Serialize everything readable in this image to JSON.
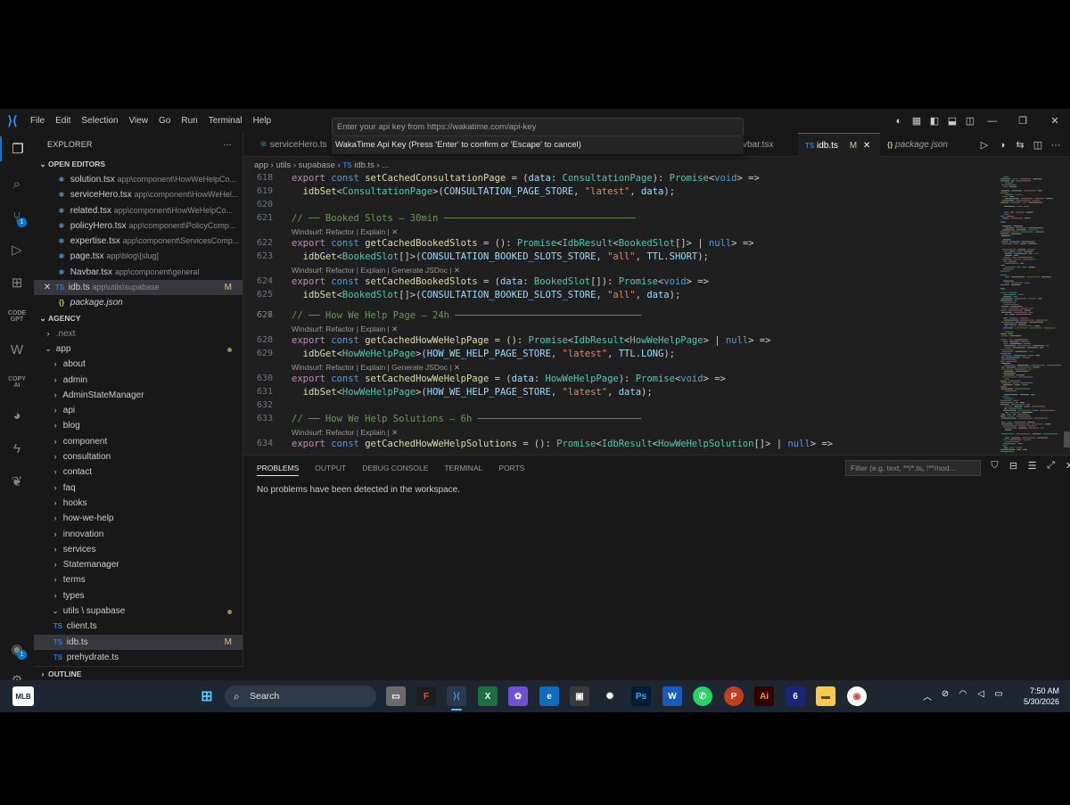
{
  "menu": [
    "File",
    "Edit",
    "Selection",
    "View",
    "Go",
    "Run",
    "Terminal",
    "Help"
  ],
  "command_palette": {
    "placeholder": "Enter your api key from https://wakatime.com/api-key",
    "hint": "WakaTime Api Key (Press 'Enter' to confirm or 'Escape' to cancel)"
  },
  "sidebar": {
    "title": "EXPLORER",
    "open_editors_title": "OPEN EDITORS",
    "open_editors": [
      {
        "name": "solution.tsx",
        "path": "app\\component\\HowWeHelpCo...",
        "icon": "react"
      },
      {
        "name": "serviceHero.tsx",
        "path": "app\\component\\HowWeHel...",
        "icon": "react"
      },
      {
        "name": "related.tsx",
        "path": "app\\component\\HowWeHelpCo...",
        "icon": "react"
      },
      {
        "name": "policyHero.tsx",
        "path": "app\\component\\PolicyComp...",
        "icon": "react"
      },
      {
        "name": "expertise.tsx",
        "path": "app\\component\\ServicesComp...",
        "icon": "react"
      },
      {
        "name": "page.tsx",
        "path": "app\\blog\\[slug]",
        "icon": "react"
      },
      {
        "name": "Navbar.tsx",
        "path": "app\\component\\general",
        "icon": "react"
      },
      {
        "name": "idb.ts",
        "path": "app\\utils\\supabase",
        "icon": "TS",
        "modified": "M"
      },
      {
        "name": "package.json",
        "path": "",
        "icon": "{}"
      }
    ],
    "project_title": "AGENCY",
    "tree": [
      {
        "name": ".next",
        "type": "folder",
        "dim": true
      },
      {
        "name": "app",
        "type": "folder-open"
      },
      {
        "name": "about",
        "type": "folder"
      },
      {
        "name": "admin",
        "type": "folder"
      },
      {
        "name": "AdminStateManager",
        "type": "folder"
      },
      {
        "name": "api",
        "type": "folder"
      },
      {
        "name": "blog",
        "type": "folder"
      },
      {
        "name": "component",
        "type": "folder"
      },
      {
        "name": "consultation",
        "type": "folder"
      },
      {
        "name": "contact",
        "type": "folder"
      },
      {
        "name": "faq",
        "type": "folder"
      },
      {
        "name": "hooks",
        "type": "folder"
      },
      {
        "name": "how-we-help",
        "type": "folder"
      },
      {
        "name": "innovation",
        "type": "folder"
      },
      {
        "name": "services",
        "type": "folder"
      },
      {
        "name": "Statemanager",
        "type": "folder"
      },
      {
        "name": "terms",
        "type": "folder"
      },
      {
        "name": "types",
        "type": "folder"
      },
      {
        "name": "utils \\ supabase",
        "type": "folder-open"
      },
      {
        "name": "client.ts",
        "type": "ts"
      },
      {
        "name": "idb.ts",
        "type": "ts",
        "modified": "M"
      },
      {
        "name": "prehydrate.ts",
        "type": "ts"
      }
    ],
    "outline_title": "OUTLINE"
  },
  "tabs": [
    {
      "name": "serviceHero.ts",
      "icon": "react"
    },
    {
      "name": "vbar.tsx",
      "icon": ""
    },
    {
      "name": "idb.ts",
      "icon": "TS",
      "modified": "M",
      "active": true
    },
    {
      "name": "package.json",
      "icon": "{}"
    }
  ],
  "breadcrumb": [
    "app",
    "utils",
    "supabase",
    "idb.ts",
    "..."
  ],
  "code": {
    "lines": [
      {
        "n": "618",
        "text": "export const setCachedConsultationPage = (data: ConsultationPage): Promise<void> =>"
      },
      {
        "n": "619",
        "text": "  idbSet<ConsultationPage>(CONSULTATION_PAGE_STORE, \"latest\", data);"
      },
      {
        "n": "620",
        "text": ""
      },
      {
        "n": "621",
        "text": "// ── Booked Slots – 30min ──────────────────────────────────"
      },
      {
        "n": "622",
        "text": "export const getCachedBookedSlots = (): Promise<IdbResult<BookedSlot[]> | null> =>"
      },
      {
        "n": "623",
        "text": "  idbGet<BookedSlot[]>(CONSULTATION_BOOKED_SLOTS_STORE, \"all\", TTL.SHORT);"
      },
      {
        "n": "624",
        "text": "export const setCachedBookedSlots = (data: BookedSlot[]): Promise<void> =>"
      },
      {
        "n": "625",
        "text": "  idbSet<BookedSlot[]>(CONSULTATION_BOOKED_SLOTS_STORE, \"all\", data);"
      },
      {
        "n": "626",
        "text": ""
      },
      {
        "n": "627",
        "text": "// ── How We Help Page – 24h ─────────────────────────────────"
      },
      {
        "n": "628",
        "text": "export const getCachedHowWeHelpPage = (): Promise<IdbResult<HowWeHelpPage> | null> =>"
      },
      {
        "n": "629",
        "text": "  idbGet<HowWeHelpPage>(HOW_WE_HELP_PAGE_STORE, \"latest\", TTL.LONG);"
      },
      {
        "n": "630",
        "text": "export const setCachedHowWeHelpPage = (data: HowWeHelpPage): Promise<void> =>"
      },
      {
        "n": "631",
        "text": "  idbSet<HowWeHelpPage>(HOW_WE_HELP_PAGE_STORE, \"latest\", data);"
      },
      {
        "n": "632",
        "text": ""
      },
      {
        "n": "633",
        "text": "// ── How We Help Solutions – 6h ─────────────────────────────"
      },
      {
        "n": "634",
        "text": "export const getCachedHowWeHelpSolutions = (): Promise<IdbResult<HowWeHelpSolution[]> | null> =>"
      }
    ],
    "lens_refactor": "Windsurf: Refactor | Explain | ✕",
    "lens_full": "Windsurf: Refactor | Explain | Generate JSDoc | ✕"
  },
  "panel": {
    "tabs": [
      "PROBLEMS",
      "OUTPUT",
      "DEBUG CONSOLE",
      "TERMINAL",
      "PORTS"
    ],
    "filter_placeholder": "Filter (e.g. text, **/*.ts, !**/nod...",
    "message": "No problems have been detected in the workspace."
  },
  "taskbar": {
    "search_label": "Search",
    "time": "7:50 AM",
    "date": "5/30/2026"
  },
  "colors": {
    "accent": "#0078d4",
    "editor_bg": "#1f1f1f",
    "sidebar_bg": "#181818",
    "taskbar_bg": "#1c2732"
  }
}
